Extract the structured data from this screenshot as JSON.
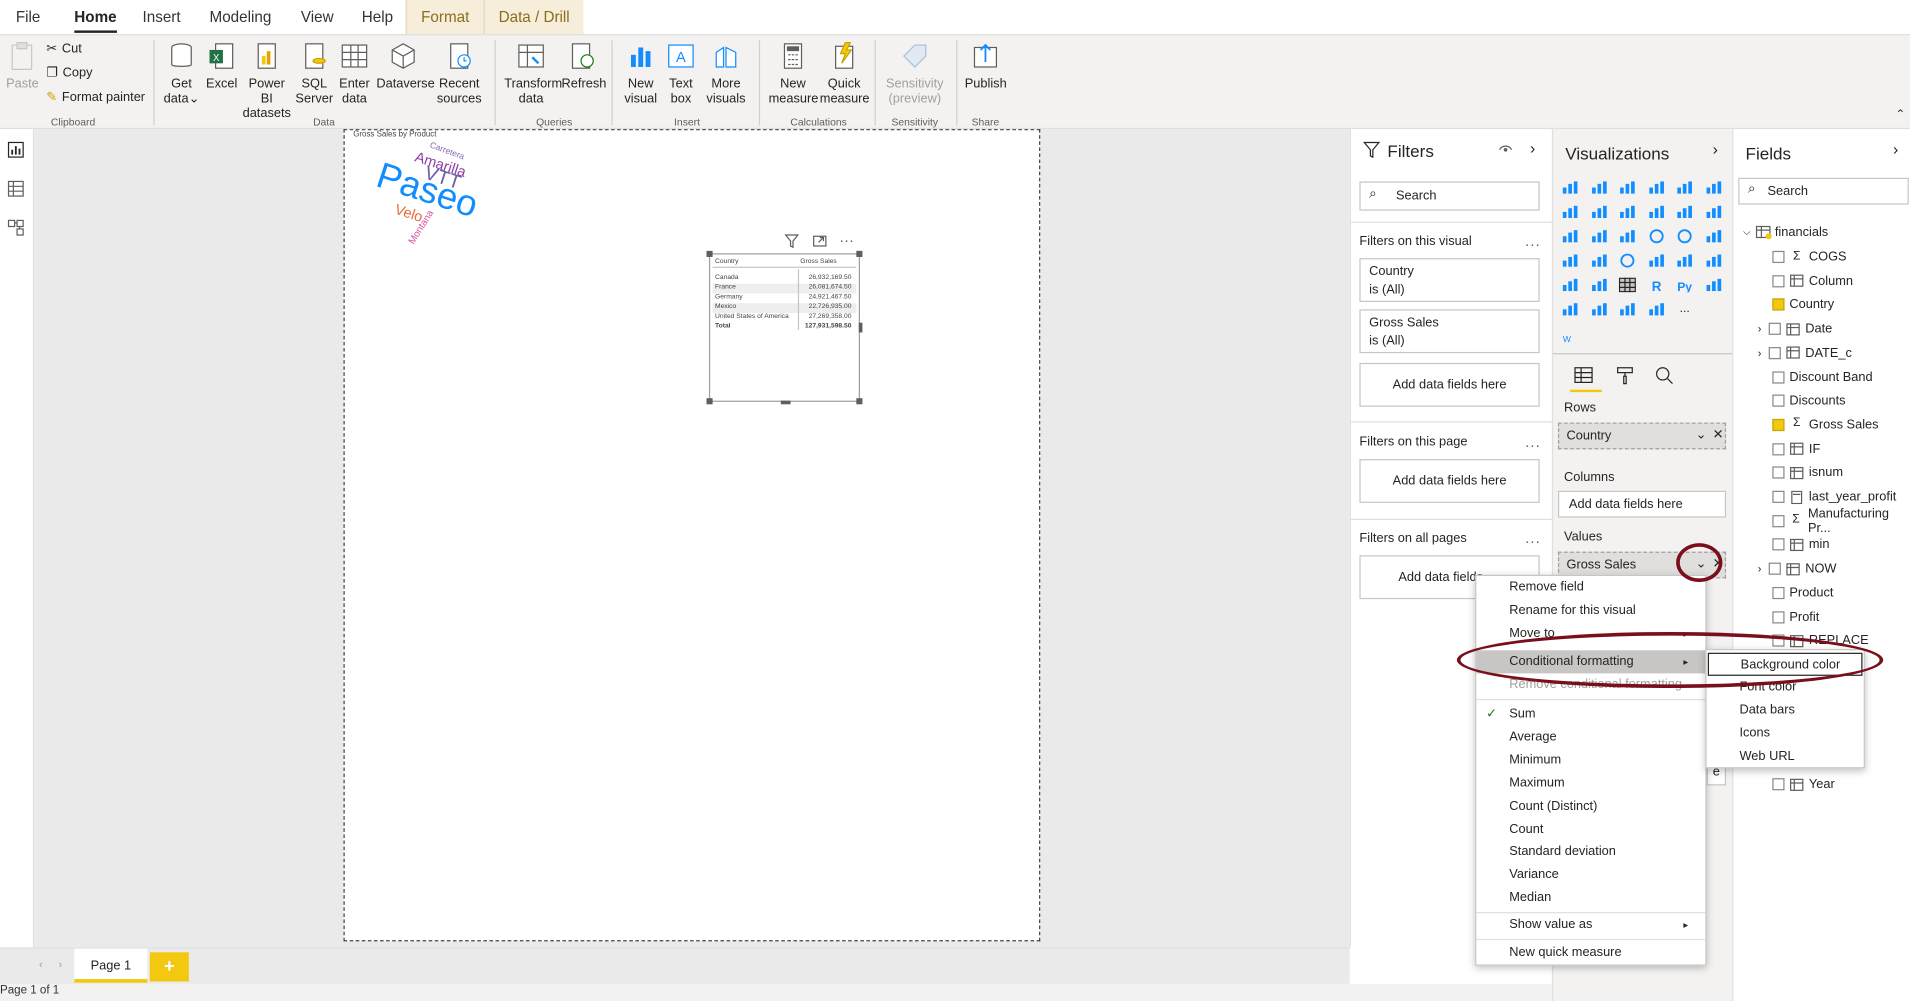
{
  "tabs": [
    "File",
    "Home",
    "Insert",
    "Modeling",
    "View",
    "Help"
  ],
  "context_tabs": [
    "Format",
    "Data / Drill"
  ],
  "ribbon": {
    "clipboard": {
      "paste": "Paste",
      "cut": "Cut",
      "copy": "Copy",
      "format_painter": "Format painter",
      "group": "Clipboard"
    },
    "data": {
      "get_data": "Get data",
      "get_data_arrow": "⌄",
      "excel": "Excel",
      "pbi_datasets": "Power BI datasets",
      "sql": "SQL Server",
      "enter_data": "Enter data",
      "dataverse": "Dataverse",
      "recent": "Recent sources",
      "group": "Data"
    },
    "queries": {
      "transform": "Transform data",
      "refresh": "Refresh",
      "group": "Queries"
    },
    "insert": {
      "new_visual": "New visual",
      "text_box": "Text box",
      "more_visuals": "More visuals",
      "group": "Insert"
    },
    "calculations": {
      "new_measure": "New measure",
      "quick_measure": "Quick measure",
      "group": "Calculations"
    },
    "sensitivity": {
      "label": "Sensitivity (preview)",
      "group": "Sensitivity"
    },
    "share": {
      "publish": "Publish",
      "group": "Share"
    }
  },
  "canvas": {
    "wordcloud_title": "Gross Sales by Product",
    "words": [
      "Carretera",
      "Amarilla",
      "VTT",
      "Paseo",
      "Velo",
      "Montana"
    ],
    "word_colors": [
      "#8764b8",
      "#8f3fa3",
      "#6b5bab",
      "#118dff",
      "#e66c37",
      "#d64f9c"
    ],
    "table": {
      "headers": [
        "Country",
        "Gross Sales"
      ],
      "rows": [
        [
          "Canada",
          "26,932,169.50"
        ],
        [
          "France",
          "26,081,674.50"
        ],
        [
          "Germany",
          "24,921,467.50"
        ],
        [
          "Mexico",
          "22,726,935.00"
        ],
        [
          "United States of America",
          "27,269,358.00"
        ]
      ],
      "total": [
        "Total",
        "127,931,598.50"
      ]
    }
  },
  "bottom": {
    "page_tab": "Page 1",
    "add_page": "+",
    "status": "Page 1 of 1"
  },
  "filters": {
    "title": "Filters",
    "search_placeholder": "Search",
    "on_visual": "Filters on this visual",
    "cards": [
      {
        "name": "Country",
        "state": "is (All)"
      },
      {
        "name": "Gross Sales",
        "state": "is (All)"
      }
    ],
    "add_fields": "Add data fields here",
    "on_page": "Filters on this page",
    "on_all_pages": "Filters on all pages",
    "add_fields_truncated": "Add data fields",
    "dots": "..."
  },
  "visualizations": {
    "title": "Visualizations",
    "custom_w": "W",
    "r_label": "R",
    "py_label": "Py",
    "more": "...",
    "wells": {
      "rows_label": "Rows",
      "rows_value": "Country",
      "columns_label": "Columns",
      "columns_add": "Add data fields here",
      "values_label": "Values",
      "values_value": "Gross Sales",
      "partial": "e"
    }
  },
  "fields": {
    "title": "Fields",
    "search_placeholder": "Search",
    "table_name": "financials",
    "items": [
      {
        "name": "COGS",
        "type": "sigma",
        "checked": false,
        "expand": false
      },
      {
        "name": "Column",
        "type": "table",
        "checked": false,
        "expand": false
      },
      {
        "name": "Country",
        "type": "none",
        "checked": true,
        "expand": false
      },
      {
        "name": "Date",
        "type": "table",
        "checked": false,
        "expand": true
      },
      {
        "name": "DATE_c",
        "type": "table",
        "checked": false,
        "expand": true
      },
      {
        "name": "Discount Band",
        "type": "none",
        "checked": false,
        "expand": false
      },
      {
        "name": "Discounts",
        "type": "none",
        "checked": false,
        "expand": false
      },
      {
        "name": "Gross Sales",
        "type": "sigma",
        "checked": true,
        "expand": false
      },
      {
        "name": "IF",
        "type": "table",
        "checked": false,
        "expand": false
      },
      {
        "name": "isnum",
        "type": "table",
        "checked": false,
        "expand": false
      },
      {
        "name": "last_year_profit",
        "type": "calc",
        "checked": false,
        "expand": false
      },
      {
        "name": "Manufacturing Pr...",
        "type": "sigma",
        "checked": false,
        "expand": false
      },
      {
        "name": "min",
        "type": "table",
        "checked": false,
        "expand": false
      },
      {
        "name": "NOW",
        "type": "table",
        "checked": false,
        "expand": true
      },
      {
        "name": "Product",
        "type": "none",
        "checked": false,
        "expand": false
      },
      {
        "name": "Profit",
        "type": "none",
        "checked": false,
        "expand": false
      },
      {
        "name": "REPLACE",
        "type": "table",
        "checked": false,
        "expand": false
      }
    ],
    "year": "Year"
  },
  "context_menu": {
    "items": [
      "Remove field",
      "Rename for this visual",
      "Move to",
      "Conditional formatting",
      "Remove conditional formatting"
    ],
    "aggregations": [
      "Sum",
      "Average",
      "Minimum",
      "Maximum",
      "Count (Distinct)",
      "Count",
      "Standard deviation",
      "Variance",
      "Median"
    ],
    "show_value_as": "Show value as",
    "new_quick_measure": "New quick measure",
    "checked": "✓",
    "arrow": "▸"
  },
  "submenu": {
    "items": [
      "Background color",
      "Font color",
      "Data bars",
      "Icons",
      "Web URL"
    ]
  },
  "colors": {
    "accent": "#f2c811",
    "annotation": "#7a0f1c",
    "format_tab_bg": "#f6eeda"
  }
}
